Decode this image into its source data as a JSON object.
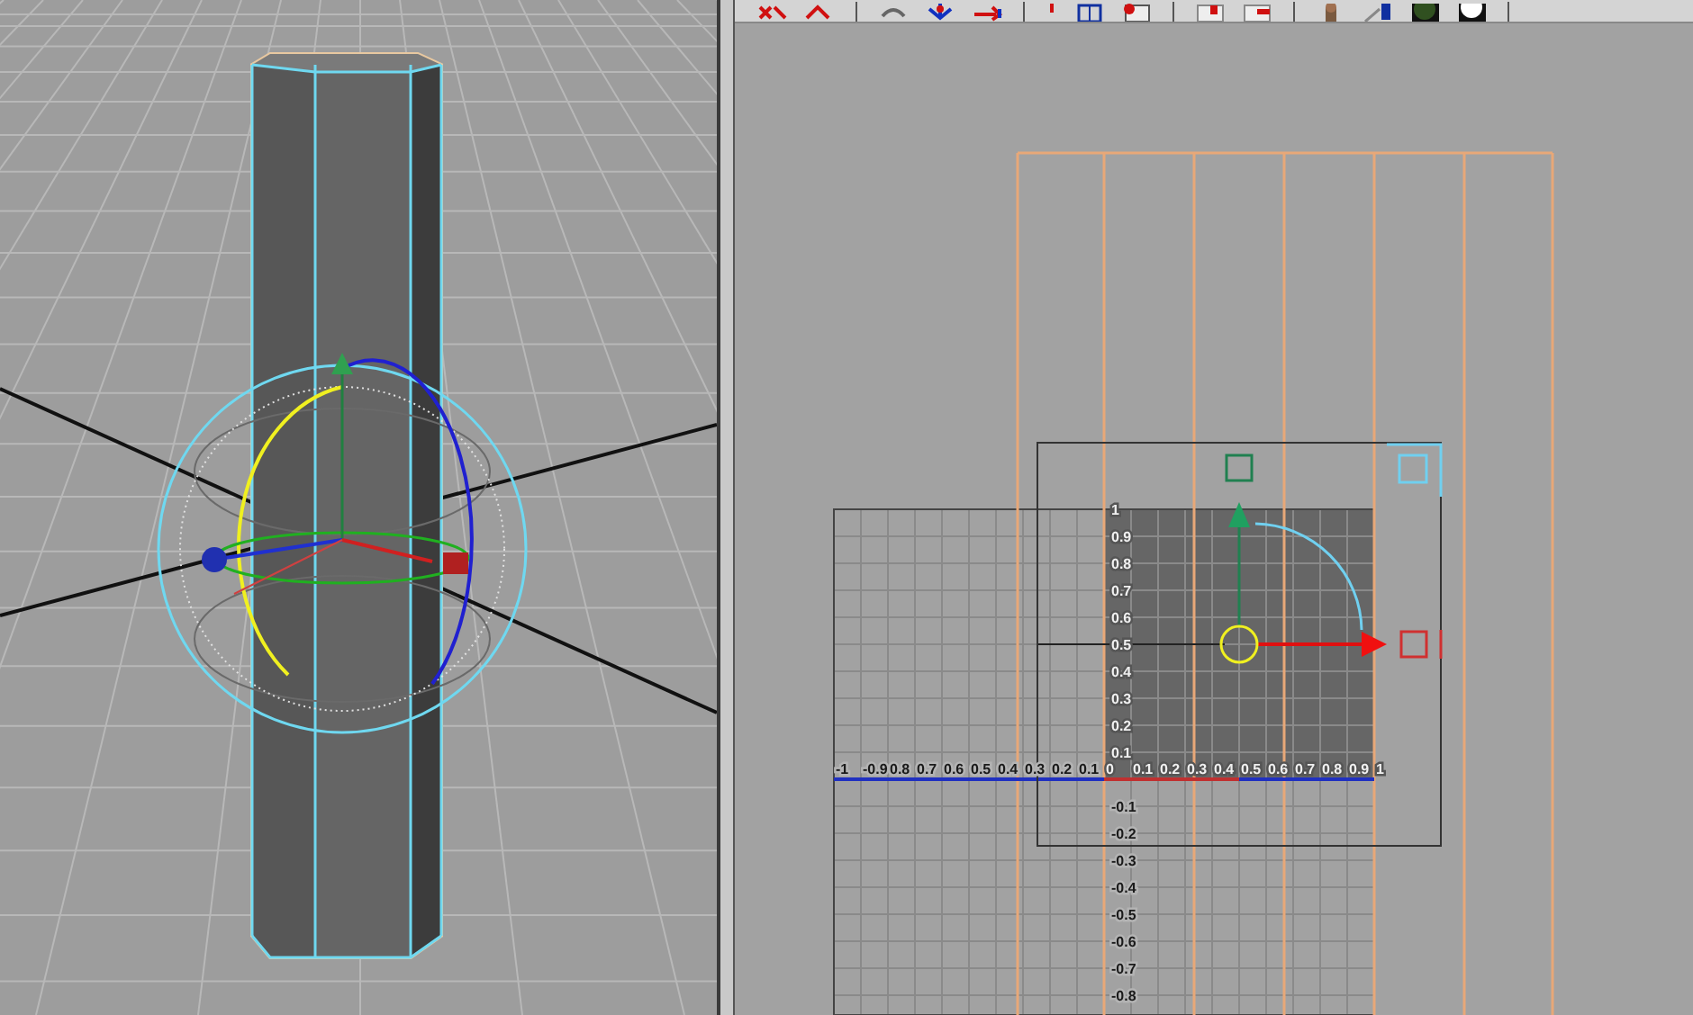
{
  "uv_editor": {
    "u_tick_labels": [
      "-1",
      "-0.9",
      "0.8",
      "0.7",
      "0.6",
      "0.5",
      "0.4",
      "0.3",
      "0.2",
      "0.1",
      "0",
      "0.1",
      "0.2",
      "0.3",
      "0.4",
      "0.5",
      "0.6",
      "0.7",
      "0.8",
      "0.9",
      "1"
    ],
    "v_tick_labels": [
      "1",
      "0.9",
      "0.8",
      "0.7",
      "0.6",
      "0.5",
      "0.4",
      "0.3",
      "0.2",
      "0.1",
      "-0.1",
      "-0.2",
      "-0.3",
      "-0.4",
      "-0.5",
      "-0.6",
      "-0.7",
      "-0.8"
    ]
  }
}
